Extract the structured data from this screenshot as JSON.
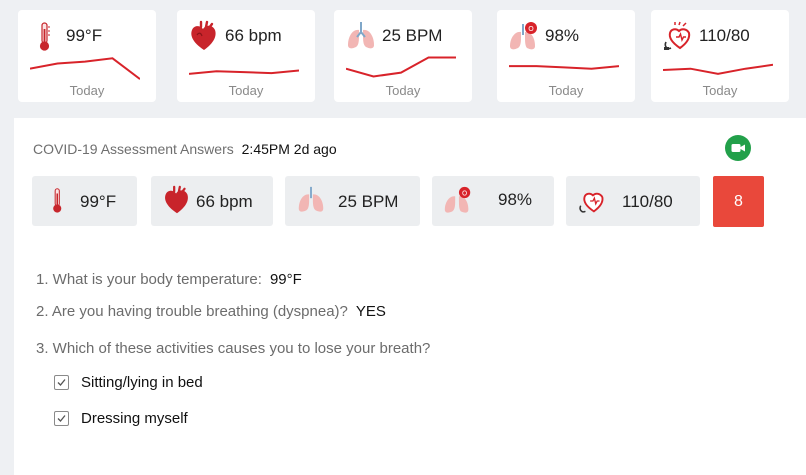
{
  "vitals": [
    {
      "icon": "thermometer-icon",
      "value": "99°F",
      "day": "Today",
      "trend": [
        0.55,
        0.75,
        0.82,
        0.95,
        0.15
      ]
    },
    {
      "icon": "heart-icon",
      "value": "66 bpm",
      "day": "Today",
      "trend": [
        0.35,
        0.45,
        0.42,
        0.38,
        0.48
      ]
    },
    {
      "icon": "lungs-icon",
      "value": "25 BPM",
      "day": "Today",
      "trend": [
        0.55,
        0.25,
        0.4,
        0.98,
        0.98
      ]
    },
    {
      "icon": "oxygen-lungs-icon",
      "value": "98%",
      "day": "Today",
      "trend": [
        0.65,
        0.65,
        0.6,
        0.55,
        0.65
      ]
    },
    {
      "icon": "blood-pressure-icon",
      "value": "110/80",
      "day": "Today",
      "trend": [
        0.5,
        0.55,
        0.35,
        0.55,
        0.7
      ]
    }
  ],
  "assessment": {
    "title": "COVID-19 Assessment Answers",
    "time": "2:45PM 2d ago",
    "video_icon": "video-camera-icon",
    "chips": [
      {
        "icon": "thermometer-icon",
        "value": "99°F"
      },
      {
        "icon": "heart-icon",
        "value": "66 bpm"
      },
      {
        "icon": "lungs-icon",
        "value": "25 BPM"
      },
      {
        "icon": "oxygen-lungs-icon",
        "value": "98%"
      },
      {
        "icon": "blood-pressure-icon",
        "value": "110/80"
      }
    ],
    "score": "8",
    "questions": [
      {
        "text": "1. What is your body temperature:",
        "answer": "99°F"
      },
      {
        "text": "2. Are you having trouble breathing (dyspnea)?",
        "answer": "YES"
      },
      {
        "text": "3. Which of these activities causes you to lose your breath?",
        "answer": ""
      }
    ],
    "options": [
      {
        "label": "Sitting/lying in bed",
        "checked": true
      },
      {
        "label": "Dressing myself",
        "checked": true
      }
    ]
  },
  "colors": {
    "trend_line": "#d8232a",
    "score_bg": "#e9483b",
    "video_green": "#22a04a"
  }
}
